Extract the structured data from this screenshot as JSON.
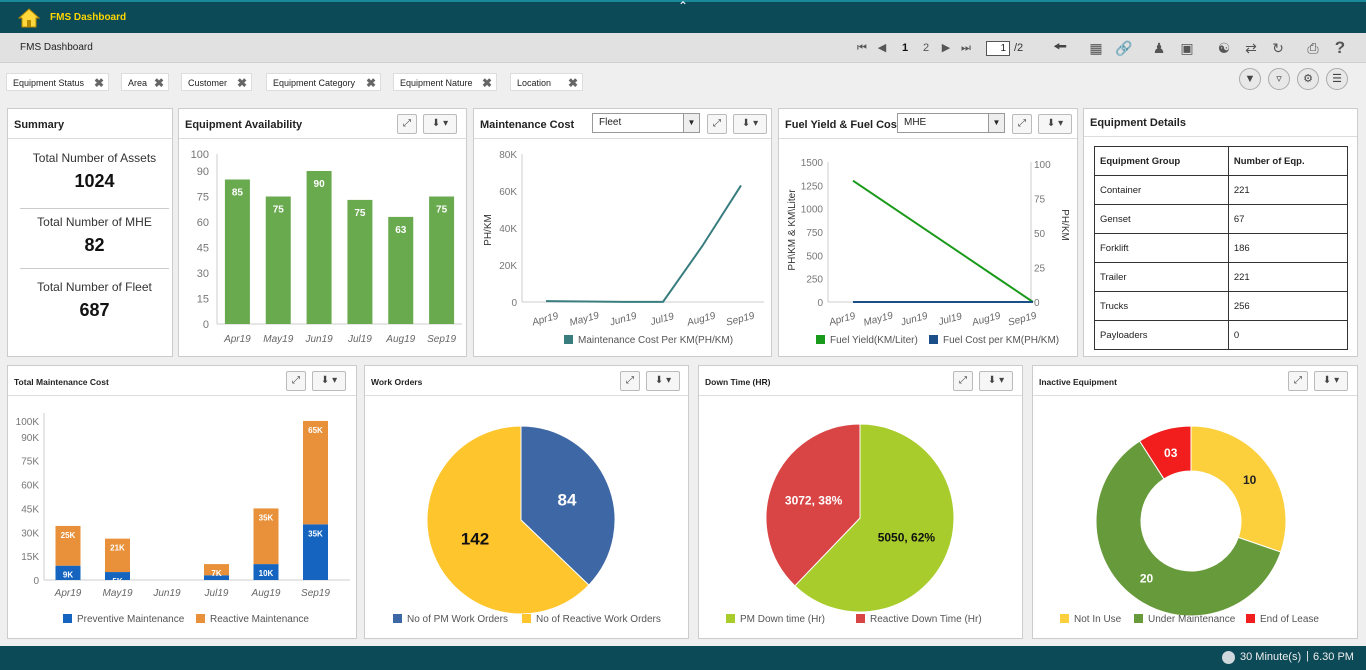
{
  "app": {
    "title": "FMS Dashboard"
  },
  "toolbar": {
    "breadcrumb": "FMS Dashboard",
    "pages": [
      "1",
      "2"
    ],
    "current_page": "1",
    "page_total": "/2"
  },
  "filters": [
    "Equipment Status",
    "Area",
    "Customer",
    "Equipment Category",
    "Equipment Nature",
    "Location"
  ],
  "summary": {
    "title": "Summary",
    "items": [
      {
        "label": "Total Number of Assets",
        "value": "1024"
      },
      {
        "label": "Total Number of MHE",
        "value": "82"
      },
      {
        "label": "Total Number of Fleet",
        "value": "687"
      }
    ]
  },
  "panels": {
    "availability": "Equipment Availability",
    "maintenance": "Maintenance Cost",
    "maintenance_select": "Fleet",
    "fuel": "Fuel Yield & Fuel Cost",
    "fuel_select": "MHE",
    "details": "Equipment Details",
    "total_maint": "Total Maintenance Cost",
    "work_orders": "Work Orders",
    "down_time": "Down Time (HR)",
    "inactive": "Inactive Equipment"
  },
  "equipment_details": {
    "headers": [
      "Equipment Group",
      "Number of Eqp."
    ],
    "rows": [
      [
        "Container",
        "221"
      ],
      [
        "Genset",
        "67"
      ],
      [
        "Forklift",
        "186"
      ],
      [
        "Trailer",
        "221"
      ],
      [
        "Trucks",
        "256"
      ],
      [
        "Payloaders",
        "0"
      ]
    ]
  },
  "chart_data": [
    {
      "id": "availability",
      "type": "bar",
      "categories": [
        "Apr19",
        "May19",
        "Jun19",
        "Jul19",
        "Aug19",
        "Sep19"
      ],
      "values": [
        85,
        75,
        90,
        73,
        63,
        75
      ],
      "data_labels": [
        "85",
        "75",
        "90",
        "75",
        "63",
        "75"
      ],
      "yticks": [
        "0",
        "15",
        "30",
        "45",
        "60",
        "75",
        "90",
        "100"
      ],
      "ylim": [
        0,
        100
      ],
      "color": "#6aaa4f"
    },
    {
      "id": "maintenance",
      "type": "line",
      "categories": [
        "Apr19",
        "May19",
        "Jun19",
        "Jul19",
        "Aug19",
        "Sep19"
      ],
      "series": [
        {
          "name": "Maintenance Cost Per KM(PH/KM)",
          "values": [
            500,
            300,
            100,
            100,
            30000,
            63000
          ],
          "color": "#3a7d7e"
        }
      ],
      "ylabel": "PH/KM",
      "yticks": [
        "0",
        "20K",
        "40K",
        "60K",
        "80K"
      ],
      "ylim": [
        0,
        80000
      ]
    },
    {
      "id": "fuel",
      "type": "line",
      "categories": [
        "Apr19",
        "May19",
        "Jun19",
        "Jul19",
        "Aug19",
        "Sep19"
      ],
      "series": [
        {
          "name": "Fuel Yield(KM/Liter)",
          "values": [
            1300,
            1040,
            780,
            520,
            260,
            0
          ],
          "color": "#1a9a1a",
          "axis": "left"
        },
        {
          "name": "Fuel Cost per KM(PH/KM)",
          "values": [
            0,
            0,
            0,
            0,
            0,
            0
          ],
          "color": "#1b4f8a",
          "axis": "right"
        }
      ],
      "ylabel": "PH\\KM & KM\\Liter",
      "ylabel2": "PH/KM",
      "yticks": [
        "0",
        "250",
        "500",
        "750",
        "1000",
        "1250",
        "1500"
      ],
      "yticks2": [
        "0",
        "25",
        "50",
        "75",
        "100"
      ],
      "ylim": [
        0,
        1500
      ],
      "ylim2": [
        0,
        100
      ]
    },
    {
      "id": "total_maint",
      "type": "bar",
      "stacked": true,
      "categories": [
        "Apr19",
        "May19",
        "Jun19",
        "Jul19",
        "Aug19",
        "Sep19"
      ],
      "series": [
        {
          "name": "Preventive Maintenance",
          "values": [
            9000,
            5000,
            0,
            3000,
            10000,
            35000
          ],
          "labels": [
            "9K",
            "5K",
            "",
            "3K",
            "10K",
            "35K"
          ],
          "color": "#1565c0"
        },
        {
          "name": "Reactive Maintenance",
          "values": [
            25000,
            21000,
            0,
            7000,
            35000,
            65000
          ],
          "labels": [
            "25K",
            "21K",
            "",
            "7K",
            "35K",
            "65K"
          ],
          "color": "#e8913a"
        }
      ],
      "yticks": [
        "0",
        "15K",
        "30K",
        "45K",
        "60K",
        "75K",
        "90K",
        "100K"
      ],
      "ylim": [
        0,
        105000
      ]
    },
    {
      "id": "work_orders",
      "type": "pie",
      "slices": [
        {
          "name": "No of PM Work Orders",
          "value": 84,
          "label": "84",
          "color": "#3d67a5"
        },
        {
          "name": "No of Reactive Work Orders",
          "value": 142,
          "label": "142",
          "color": "#ffc52c"
        }
      ]
    },
    {
      "id": "down_time",
      "type": "pie",
      "slices": [
        {
          "name": "PM Down time (Hr)",
          "value": 5050,
          "label": "5050, 62%",
          "color": "#a7cc2c"
        },
        {
          "name": "Reactive Down Time (Hr)",
          "value": 3072,
          "label": "3072, 38%",
          "color": "#d94545"
        }
      ]
    },
    {
      "id": "inactive",
      "type": "pie",
      "donut": true,
      "slices": [
        {
          "name": "Not In Use",
          "value": 10,
          "label": "10",
          "color": "#fbd03c"
        },
        {
          "name": "Under Maintenance",
          "value": 20,
          "label": "20",
          "color": "#679a3b"
        },
        {
          "name": "End of Lease",
          "value": 3,
          "label": "03",
          "color": "#f21e1e"
        }
      ]
    }
  ],
  "status": {
    "refresh": "30 Minute(s)",
    "time": "6.30 PM"
  }
}
